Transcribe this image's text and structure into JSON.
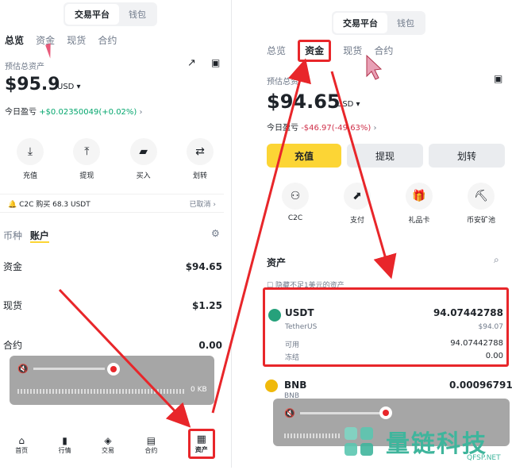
{
  "left": {
    "segment": [
      "交易平台",
      "钱包"
    ],
    "tabs": [
      "总览",
      "资金",
      "现货",
      "合约"
    ],
    "est_label": "预估总资产",
    "balance": "$95.9",
    "currency": "USD ▾",
    "pnl_label": "今日盈亏",
    "pnl_value": "+$0.02350049(+0.02%)",
    "actions": [
      "充值",
      "提现",
      "买入",
      "划转"
    ],
    "notice_text": "C2C 购买 68.3 USDT",
    "notice_status": "已取消",
    "subtabs": [
      "币种",
      "账户"
    ],
    "rows": [
      {
        "label": "资金",
        "value": "$94.65"
      },
      {
        "label": "现货",
        "value": "$1.25"
      },
      {
        "label": "合约",
        "value": "0.00"
      }
    ],
    "recorder_size": "0 KB",
    "bottom_nav": [
      "首页",
      "行情",
      "交易",
      "合约",
      "资产"
    ]
  },
  "right": {
    "segment": [
      "交易平台",
      "钱包"
    ],
    "tabs": [
      "总览",
      "资金",
      "现货",
      "合约"
    ],
    "est_label": "预估总资产",
    "balance": "$94.65",
    "currency": "USD ▾",
    "pnl_label": "今日盈亏",
    "pnl_value": "-$46.97(-49.63%)",
    "buttons": [
      "充值",
      "提现",
      "划转"
    ],
    "actions": [
      "C2C",
      "支付",
      "礼品卡",
      "币安矿池"
    ],
    "assets_title": "资产",
    "hide_small": "隐藏不足1美元的资产",
    "usdt": {
      "symbol": "USDT",
      "name": "TetherUS",
      "amount": "94.07442788",
      "usd": "$94.07",
      "avail_label": "可用",
      "avail": "94.07442788",
      "frozen_label": "冻结",
      "frozen": "0.00"
    },
    "bnb": {
      "symbol": "BNB",
      "amount": "0.00096791",
      "name": "BNB"
    }
  },
  "watermark": {
    "brand": "量链科技",
    "url": "QFSP.NET"
  },
  "colors": {
    "accent": "#fcd535",
    "red": "#e8262a",
    "green": "#03a66d",
    "loss": "#cf304a"
  }
}
